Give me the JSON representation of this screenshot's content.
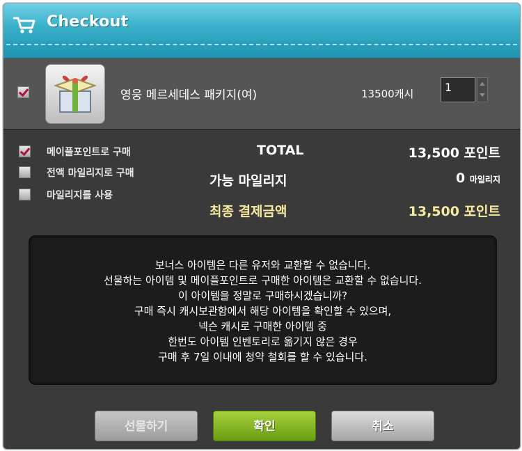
{
  "window": {
    "title": "Checkout",
    "accent_color": "#38aec9",
    "icon": "cart-icon"
  },
  "item": {
    "checked": true,
    "image": "gift-box-icon",
    "name": "영웅 메르세데스 패키지(여)",
    "price": "13500캐시",
    "quantity": "1"
  },
  "options": [
    {
      "label": "메이플포인트로 구매",
      "checked": true
    },
    {
      "label": "전액 마일리지로 구매",
      "checked": false
    },
    {
      "label": "마일리지를 사용",
      "checked": false
    }
  ],
  "summary": {
    "total_label": "TOTAL",
    "total_value": "13,500 포인트",
    "mileage_label": "가능 마일리지",
    "mileage_value": "0",
    "mileage_unit": "마일리지",
    "final_label": "최종 결제금액",
    "final_value": "13,500 포인트",
    "highlight_color": "#f7eaa0"
  },
  "notice": {
    "lines": [
      "보너스 아이템은 다른 유저와 교환할 수 없습니다.",
      "선물하는 아이템 및 메이플포인트로 구매한 아이템은 교환할 수 없습니다.",
      "이 아이템을 정말로 구매하시겠습니까?",
      "구매 즉시 캐시보관함에서 해당 아이템을 확인할 수 있으며,",
      "넥슨 캐시로 구매한 아이템 중",
      "한번도 아이템 인벤토리로 옮기지 않은 경우",
      "구매 후 7일 이내에 청약 철회를 할 수 있습니다."
    ]
  },
  "buttons": {
    "gift": "선물하기",
    "confirm": "확인",
    "cancel": "취소"
  }
}
